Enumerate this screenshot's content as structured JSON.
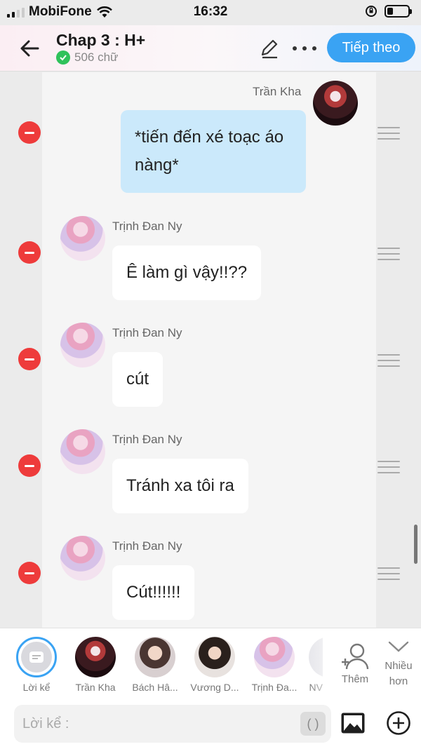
{
  "status_bar": {
    "carrier": "MobiFone",
    "time": "16:32"
  },
  "header": {
    "title": "Chap 3 : H+",
    "word_count": "506 chữ",
    "next_label": "Tiếp theo"
  },
  "messages": [
    {
      "sender": "Trần Kha",
      "text": "*tiến đến xé toạc áo nàng*",
      "side": "right",
      "avatar": "tran-kha-avatar"
    },
    {
      "sender": "Trịnh Đan Ny",
      "text": "Ê làm gì vậy!!??",
      "side": "left",
      "avatar": "trinh-dan-ny-avatar"
    },
    {
      "sender": "Trịnh Đan Ny",
      "text": "cút",
      "side": "left",
      "avatar": "trinh-dan-ny-avatar"
    },
    {
      "sender": "Trịnh Đan Ny",
      "text": "Tránh xa tôi ra",
      "side": "left",
      "avatar": "trinh-dan-ny-avatar"
    },
    {
      "sender": "Trịnh Đan Ny",
      "text": "Cút!!!!!!",
      "side": "left",
      "avatar": "trinh-dan-ny-avatar"
    }
  ],
  "characters": [
    {
      "label": "Lời kể",
      "selected": true
    },
    {
      "label": "Trần Kha"
    },
    {
      "label": "Bách Hâ..."
    },
    {
      "label": "Vương D..."
    },
    {
      "label": "Trịnh Đa..."
    },
    {
      "label": "NV"
    }
  ],
  "character_actions": {
    "add_label": "Thêm",
    "more_label": "Nhiều hơn"
  },
  "composer": {
    "placeholder": "Lời kể :",
    "paren_label": "( )"
  },
  "colors": {
    "accent": "#3aa3f3",
    "delete": "#ee3b3b",
    "my_bubble": "#cbe9fb",
    "verified": "#2fc25b"
  }
}
